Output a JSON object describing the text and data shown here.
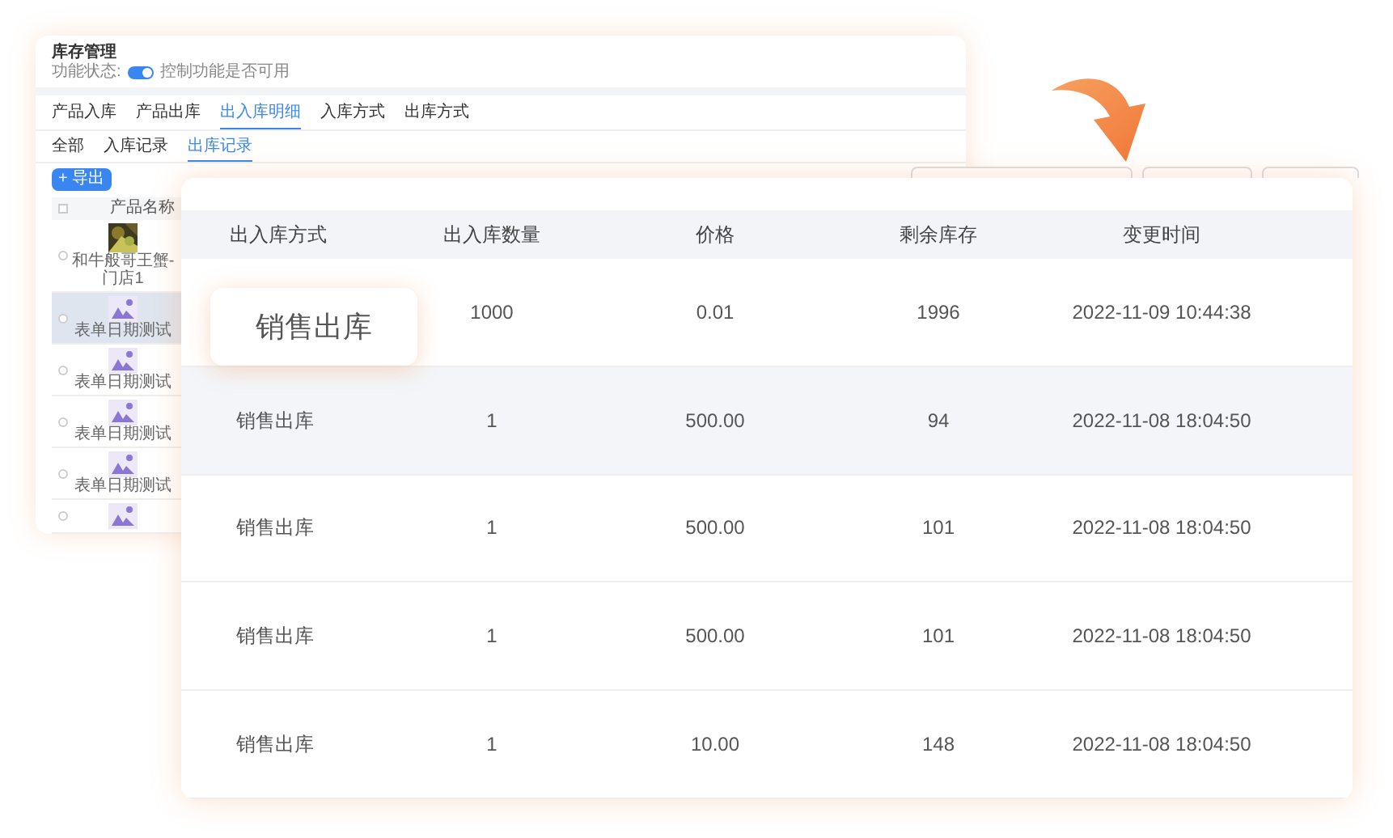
{
  "back_window": {
    "title": "库存管理",
    "status_label": "功能状态:",
    "toggle": {
      "on": true
    },
    "status_hint": "控制功能是否可用",
    "tabs": [
      {
        "label": "产品入库",
        "selected": false
      },
      {
        "label": "产品出库",
        "selected": false
      },
      {
        "label": "出入库明细",
        "selected": true
      },
      {
        "label": "入库方式",
        "selected": false
      },
      {
        "label": "出库方式",
        "selected": false
      }
    ],
    "subtabs": [
      {
        "label": "全部",
        "selected": false
      },
      {
        "label": "入库记录",
        "selected": false
      },
      {
        "label": "出库记录",
        "selected": true
      }
    ],
    "export_button": "+ 导出",
    "table": {
      "select_all": {
        "checked": false
      },
      "columns": [
        "产品名称"
      ],
      "rows": [
        {
          "name": "和牛般哥王蟹-门店1",
          "highlighted": false,
          "checked": false
        },
        {
          "kind": "placeholder",
          "name": "表单日期测试",
          "highlighted": true,
          "checked": false
        },
        {
          "kind": "placeholder",
          "name": "表单日期测试",
          "highlighted": false,
          "checked": false
        },
        {
          "kind": "placeholder",
          "name": "表单日期测试",
          "highlighted": false,
          "checked": false
        },
        {
          "kind": "placeholder",
          "name": "表单日期测试",
          "highlighted": false,
          "checked": false
        },
        {
          "kind": "placeholder",
          "highlighted": false,
          "checked": false
        }
      ]
    }
  },
  "front_table": {
    "columns": [
      "出入库方式",
      "出入库数量",
      "价格",
      "剩余库存",
      "变更时间"
    ],
    "rows": [
      {
        "cells": [
          "销售出库",
          "1000",
          "0.01",
          "1996",
          "2022-11-09 10:44:38"
        ],
        "highlighted": false,
        "callout": true
      },
      {
        "cells": [
          "销售出库",
          "1",
          "500.00",
          "94",
          "2022-11-08 18:04:50"
        ],
        "highlighted": true,
        "callout": false
      },
      {
        "cells": [
          "销售出库",
          "1",
          "500.00",
          "101",
          "2022-11-08 18:04:50"
        ],
        "highlighted": false,
        "callout": false
      },
      {
        "cells": [
          "销售出库",
          "1",
          "500.00",
          "101",
          "2022-11-08 18:04:50"
        ],
        "highlighted": false,
        "callout": false
      },
      {
        "cells": [
          "销售出库",
          "1",
          "10.00",
          "148",
          "2022-11-08 18:04:50"
        ],
        "highlighted": false,
        "callout": false
      }
    ]
  }
}
